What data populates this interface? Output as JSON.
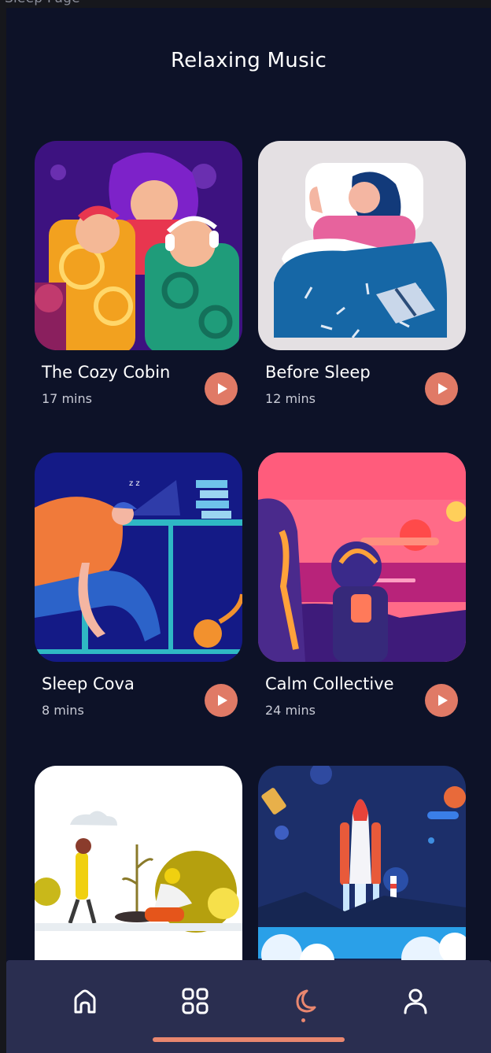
{
  "frame_label": "Sleep Page",
  "title": "Relaxing Music",
  "tracks": [
    {
      "title": "The Cozy Cobin",
      "duration": "17 mins",
      "art": "crowd-headphones-illustration"
    },
    {
      "title": "Before Sleep",
      "duration": "12 mins",
      "art": "woman-sleeping-illustration"
    },
    {
      "title": "Sleep Cova",
      "duration": "8 mins",
      "art": "man-asleep-at-desk-illustration"
    },
    {
      "title": "Calm Collective",
      "duration": "24 mins",
      "art": "astronauts-sunset-illustration"
    },
    {
      "art": "gardening-illustration"
    },
    {
      "art": "space-shuttle-launch-illustration"
    }
  ],
  "nav": {
    "items": [
      {
        "icon": "home-icon",
        "active": false
      },
      {
        "icon": "grid-icon",
        "active": false
      },
      {
        "icon": "moon-icon",
        "active": true
      },
      {
        "icon": "profile-icon",
        "active": false
      }
    ]
  },
  "colors": {
    "background": "#0d1228",
    "accent": "#e07a66",
    "nav_background": "#2a2e50",
    "text_primary": "#ffffff",
    "text_secondary": "#c9cbd6"
  }
}
